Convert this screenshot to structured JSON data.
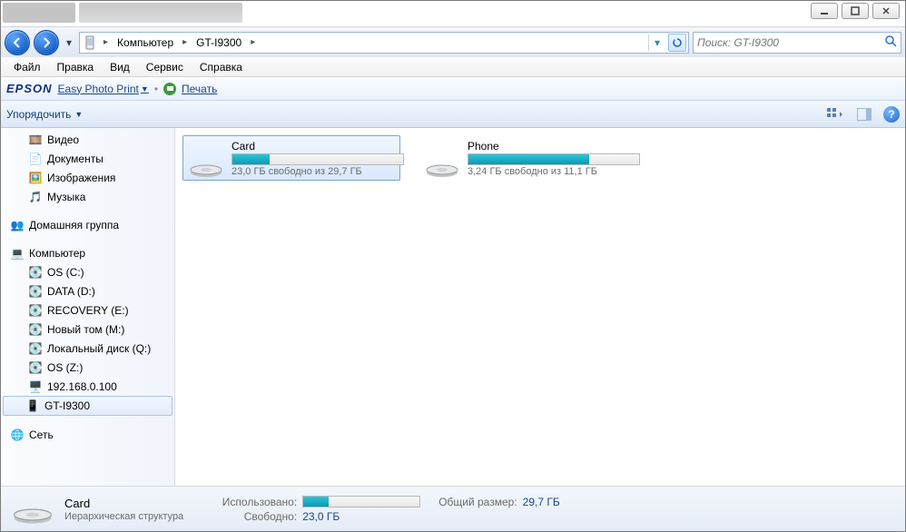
{
  "breadcrumb": {
    "root": "Компьютер",
    "item": "GT-I9300"
  },
  "search": {
    "placeholder": "Поиск: GT-I9300"
  },
  "menubar": {
    "file": "Файл",
    "edit": "Правка",
    "view": "Вид",
    "service": "Сервис",
    "help": "Справка"
  },
  "epson": {
    "logo": "EPSON",
    "link": "Easy Photo Print",
    "print": "Печать"
  },
  "cmdbar": {
    "organize": "Упорядочить"
  },
  "nav": {
    "video": "Видео",
    "documents": "Документы",
    "pictures": "Изображения",
    "music": "Музыка",
    "homegroup": "Домашняя группа",
    "computer": "Компьютер",
    "drives": [
      "OS (C:)",
      "DATA (D:)",
      "RECOVERY (E:)",
      "Новый том (M:)",
      "Локальный диск (Q:)",
      "OS (Z:)",
      "192.168.0.100",
      "GT-I9300"
    ],
    "network": "Сеть"
  },
  "drives": [
    {
      "name": "Card",
      "freetext": "23,0 ГБ свободно из 29,7 ГБ",
      "fill_pct": 22,
      "selected": true
    },
    {
      "name": "Phone",
      "freetext": "3,24 ГБ свободно из 11,1 ГБ",
      "fill_pct": 71,
      "selected": false
    }
  ],
  "details": {
    "title": "Card",
    "sub": "Иерархическая структура",
    "used_label": "Использовано:",
    "used_fill_pct": 22,
    "free_label": "Свободно:",
    "free_val": "23,0 ГБ",
    "total_label": "Общий размер:",
    "total_val": "29,7 ГБ"
  }
}
